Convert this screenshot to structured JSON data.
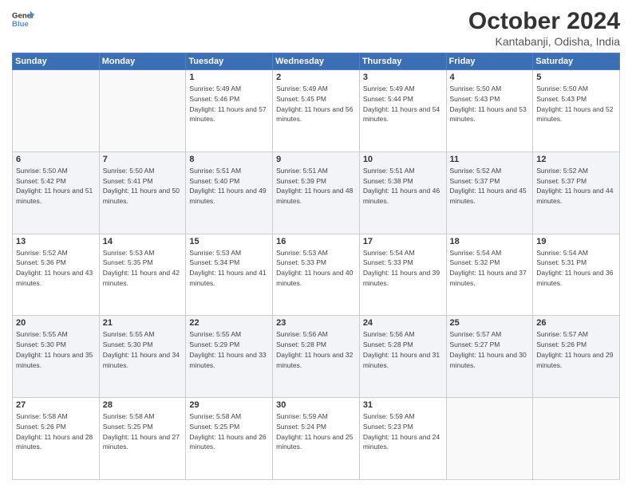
{
  "header": {
    "logo_line1": "General",
    "logo_line2": "Blue",
    "month_title": "October 2024",
    "location": "Kantabanji, Odisha, India"
  },
  "weekdays": [
    "Sunday",
    "Monday",
    "Tuesday",
    "Wednesday",
    "Thursday",
    "Friday",
    "Saturday"
  ],
  "weeks": [
    [
      {
        "day": "",
        "sunrise": "",
        "sunset": "",
        "daylight": ""
      },
      {
        "day": "",
        "sunrise": "",
        "sunset": "",
        "daylight": ""
      },
      {
        "day": "1",
        "sunrise": "Sunrise: 5:49 AM",
        "sunset": "Sunset: 5:46 PM",
        "daylight": "Daylight: 11 hours and 57 minutes."
      },
      {
        "day": "2",
        "sunrise": "Sunrise: 5:49 AM",
        "sunset": "Sunset: 5:45 PM",
        "daylight": "Daylight: 11 hours and 56 minutes."
      },
      {
        "day": "3",
        "sunrise": "Sunrise: 5:49 AM",
        "sunset": "Sunset: 5:44 PM",
        "daylight": "Daylight: 11 hours and 54 minutes."
      },
      {
        "day": "4",
        "sunrise": "Sunrise: 5:50 AM",
        "sunset": "Sunset: 5:43 PM",
        "daylight": "Daylight: 11 hours and 53 minutes."
      },
      {
        "day": "5",
        "sunrise": "Sunrise: 5:50 AM",
        "sunset": "Sunset: 5:43 PM",
        "daylight": "Daylight: 11 hours and 52 minutes."
      }
    ],
    [
      {
        "day": "6",
        "sunrise": "Sunrise: 5:50 AM",
        "sunset": "Sunset: 5:42 PM",
        "daylight": "Daylight: 11 hours and 51 minutes."
      },
      {
        "day": "7",
        "sunrise": "Sunrise: 5:50 AM",
        "sunset": "Sunset: 5:41 PM",
        "daylight": "Daylight: 11 hours and 50 minutes."
      },
      {
        "day": "8",
        "sunrise": "Sunrise: 5:51 AM",
        "sunset": "Sunset: 5:40 PM",
        "daylight": "Daylight: 11 hours and 49 minutes."
      },
      {
        "day": "9",
        "sunrise": "Sunrise: 5:51 AM",
        "sunset": "Sunset: 5:39 PM",
        "daylight": "Daylight: 11 hours and 48 minutes."
      },
      {
        "day": "10",
        "sunrise": "Sunrise: 5:51 AM",
        "sunset": "Sunset: 5:38 PM",
        "daylight": "Daylight: 11 hours and 46 minutes."
      },
      {
        "day": "11",
        "sunrise": "Sunrise: 5:52 AM",
        "sunset": "Sunset: 5:37 PM",
        "daylight": "Daylight: 11 hours and 45 minutes."
      },
      {
        "day": "12",
        "sunrise": "Sunrise: 5:52 AM",
        "sunset": "Sunset: 5:37 PM",
        "daylight": "Daylight: 11 hours and 44 minutes."
      }
    ],
    [
      {
        "day": "13",
        "sunrise": "Sunrise: 5:52 AM",
        "sunset": "Sunset: 5:36 PM",
        "daylight": "Daylight: 11 hours and 43 minutes."
      },
      {
        "day": "14",
        "sunrise": "Sunrise: 5:53 AM",
        "sunset": "Sunset: 5:35 PM",
        "daylight": "Daylight: 11 hours and 42 minutes."
      },
      {
        "day": "15",
        "sunrise": "Sunrise: 5:53 AM",
        "sunset": "Sunset: 5:34 PM",
        "daylight": "Daylight: 11 hours and 41 minutes."
      },
      {
        "day": "16",
        "sunrise": "Sunrise: 5:53 AM",
        "sunset": "Sunset: 5:33 PM",
        "daylight": "Daylight: 11 hours and 40 minutes."
      },
      {
        "day": "17",
        "sunrise": "Sunrise: 5:54 AM",
        "sunset": "Sunset: 5:33 PM",
        "daylight": "Daylight: 11 hours and 39 minutes."
      },
      {
        "day": "18",
        "sunrise": "Sunrise: 5:54 AM",
        "sunset": "Sunset: 5:32 PM",
        "daylight": "Daylight: 11 hours and 37 minutes."
      },
      {
        "day": "19",
        "sunrise": "Sunrise: 5:54 AM",
        "sunset": "Sunset: 5:31 PM",
        "daylight": "Daylight: 11 hours and 36 minutes."
      }
    ],
    [
      {
        "day": "20",
        "sunrise": "Sunrise: 5:55 AM",
        "sunset": "Sunset: 5:30 PM",
        "daylight": "Daylight: 11 hours and 35 minutes."
      },
      {
        "day": "21",
        "sunrise": "Sunrise: 5:55 AM",
        "sunset": "Sunset: 5:30 PM",
        "daylight": "Daylight: 11 hours and 34 minutes."
      },
      {
        "day": "22",
        "sunrise": "Sunrise: 5:55 AM",
        "sunset": "Sunset: 5:29 PM",
        "daylight": "Daylight: 11 hours and 33 minutes."
      },
      {
        "day": "23",
        "sunrise": "Sunrise: 5:56 AM",
        "sunset": "Sunset: 5:28 PM",
        "daylight": "Daylight: 11 hours and 32 minutes."
      },
      {
        "day": "24",
        "sunrise": "Sunrise: 5:56 AM",
        "sunset": "Sunset: 5:28 PM",
        "daylight": "Daylight: 11 hours and 31 minutes."
      },
      {
        "day": "25",
        "sunrise": "Sunrise: 5:57 AM",
        "sunset": "Sunset: 5:27 PM",
        "daylight": "Daylight: 11 hours and 30 minutes."
      },
      {
        "day": "26",
        "sunrise": "Sunrise: 5:57 AM",
        "sunset": "Sunset: 5:26 PM",
        "daylight": "Daylight: 11 hours and 29 minutes."
      }
    ],
    [
      {
        "day": "27",
        "sunrise": "Sunrise: 5:58 AM",
        "sunset": "Sunset: 5:26 PM",
        "daylight": "Daylight: 11 hours and 28 minutes."
      },
      {
        "day": "28",
        "sunrise": "Sunrise: 5:58 AM",
        "sunset": "Sunset: 5:25 PM",
        "daylight": "Daylight: 11 hours and 27 minutes."
      },
      {
        "day": "29",
        "sunrise": "Sunrise: 5:58 AM",
        "sunset": "Sunset: 5:25 PM",
        "daylight": "Daylight: 11 hours and 26 minutes."
      },
      {
        "day": "30",
        "sunrise": "Sunrise: 5:59 AM",
        "sunset": "Sunset: 5:24 PM",
        "daylight": "Daylight: 11 hours and 25 minutes."
      },
      {
        "day": "31",
        "sunrise": "Sunrise: 5:59 AM",
        "sunset": "Sunset: 5:23 PM",
        "daylight": "Daylight: 11 hours and 24 minutes."
      },
      {
        "day": "",
        "sunrise": "",
        "sunset": "",
        "daylight": ""
      },
      {
        "day": "",
        "sunrise": "",
        "sunset": "",
        "daylight": ""
      }
    ]
  ]
}
